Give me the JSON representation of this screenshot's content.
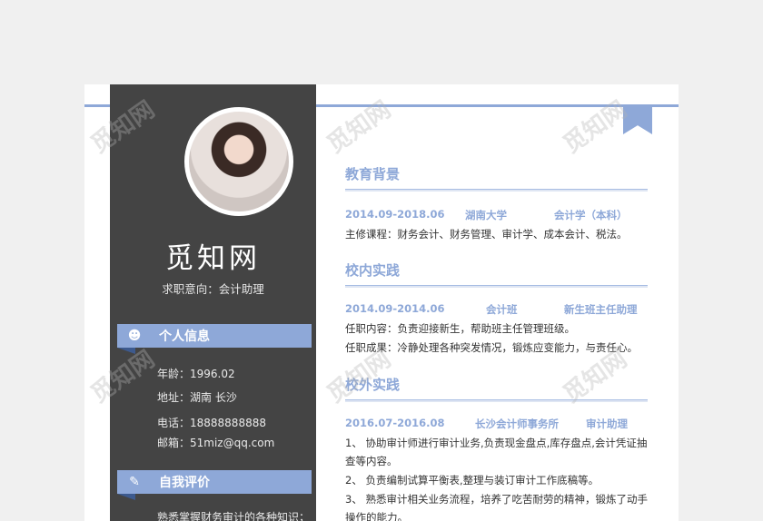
{
  "profile": {
    "name": "觅知网",
    "intent": "求职意向：会计助理"
  },
  "personal": {
    "title": "个人信息",
    "age": "年龄：1996.02",
    "address": "地址：湖南  长沙",
    "phone": "电话：18888888888",
    "email": "邮箱：51miz@qq.com"
  },
  "self": {
    "title": "自我评价",
    "text": "熟悉掌握财务审计的各种知识；能"
  },
  "education": {
    "title": "教育背景",
    "date": "2014.09-2018.06",
    "school": "湖南大学",
    "major": "会计学（本科）",
    "course": "主修课程：财务会计、财务管理、审计学、成本会计、税法。"
  },
  "campus": {
    "title": "校内实践",
    "date": "2014.09-2014.06",
    "org": "会计班",
    "role": "新生班主任助理",
    "content": "任职内容：负责迎接新生，帮助班主任管理班级。",
    "result": "任职成果：冷静处理各种突发情况，锻炼应变能力，与责任心。"
  },
  "external": {
    "title": "校外实践",
    "date": "2016.07-2016.08",
    "org": "长沙会计师事务所",
    "role": "审计助理",
    "items": [
      "1、  协助审计师进行审计业务,负责现金盘点,库存盘点,会计凭证抽",
      "       查等内容。",
      "2、  负责编制试算平衡表,整理与装订审计工作底稿等。",
      "3、  熟悉审计相关业务流程，培养了吃苦耐劳的精神，锻炼了动手",
      "       操作的能力。"
    ]
  },
  "watermark": "觅知网",
  "colors": {
    "accent": "#8ea8d8",
    "sidebar": "#444444"
  }
}
